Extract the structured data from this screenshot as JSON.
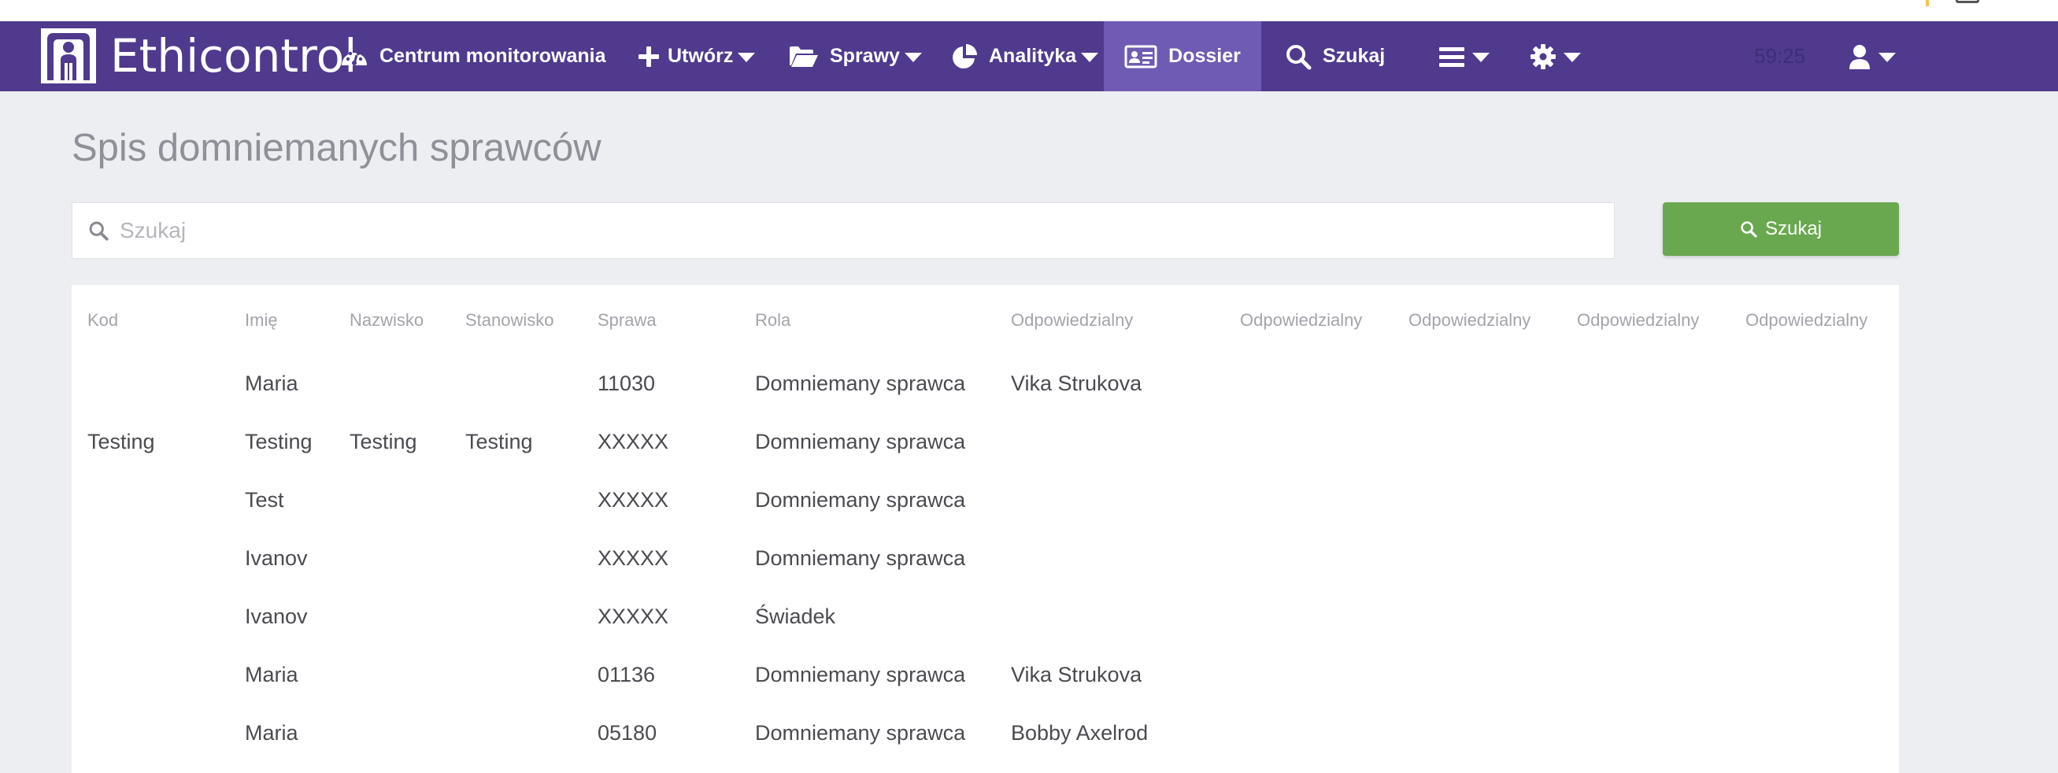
{
  "brand": {
    "name": "Ethicontrol"
  },
  "nav": {
    "monitoring": "Centrum monitorowania",
    "create": "Utwórz",
    "cases": "Sprawy",
    "analytics": "Analityka",
    "dossier": "Dossier",
    "search": "Szukaj",
    "timer": "59:25"
  },
  "page": {
    "title": "Spis domniemanych sprawców"
  },
  "search": {
    "placeholder": "Szukaj",
    "button_label": "Szukaj"
  },
  "table": {
    "columns": [
      "Kod",
      "Imię",
      "Nazwisko",
      "Stanowisko",
      "Sprawa",
      "Rola",
      "Odpowiedzialny",
      "Odpowiedzialny",
      "Odpowiedzialny",
      "Odpowiedzialny",
      "Odpowiedzialny"
    ],
    "rows": [
      [
        "",
        "Maria",
        "",
        "",
        "11030",
        "Domniemany sprawca",
        "Vika Strukova",
        "",
        "",
        "",
        ""
      ],
      [
        "Testing",
        "Testing",
        "Testing",
        "Testing",
        "XXXXX",
        "Domniemany sprawca",
        "",
        "",
        "",
        "",
        ""
      ],
      [
        "",
        "Test",
        "",
        "",
        "XXXXX",
        "Domniemany sprawca",
        "",
        "",
        "",
        "",
        ""
      ],
      [
        "",
        "Ivanov",
        "",
        "",
        "XXXXX",
        "Domniemany sprawca",
        "",
        "",
        "",
        "",
        ""
      ],
      [
        "",
        "Ivanov",
        "",
        "",
        "XXXXX",
        "Świadek",
        "",
        "",
        "",
        "",
        ""
      ],
      [
        "",
        "Maria",
        "",
        "",
        "01136",
        "Domniemany sprawca",
        "Vika Strukova",
        "",
        "",
        "",
        ""
      ],
      [
        "",
        "Maria",
        "",
        "",
        "05180",
        "Domniemany sprawca",
        "Bobby Axelrod",
        "",
        "",
        "",
        ""
      ]
    ]
  },
  "colors": {
    "navbar": "#4f3a8e",
    "nav_active": "#6f5bb3",
    "search_button": "#6aa84f",
    "background": "#edeef2"
  }
}
